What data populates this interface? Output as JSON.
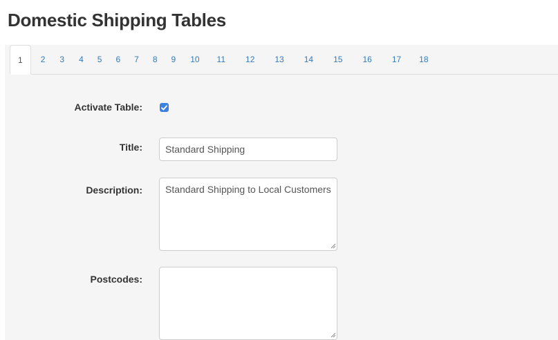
{
  "page": {
    "title": "Domestic Shipping Tables"
  },
  "tabs": [
    "1",
    "2",
    "3",
    "4",
    "5",
    "6",
    "7",
    "8",
    "9",
    "10",
    "11",
    "12",
    "13",
    "14",
    "15",
    "16",
    "17",
    "18"
  ],
  "active_tab": "1",
  "form": {
    "activate_label": "Activate Table:",
    "activate_checked": true,
    "title_label": "Title:",
    "title_value": "Standard Shipping",
    "description_label": "Description:",
    "description_value": "Standard Shipping to Local Customers",
    "postcodes_label": "Postcodes:",
    "postcodes_value": ""
  },
  "colors": {
    "link": "#337ab7",
    "checkbox": "#3b82e0"
  }
}
